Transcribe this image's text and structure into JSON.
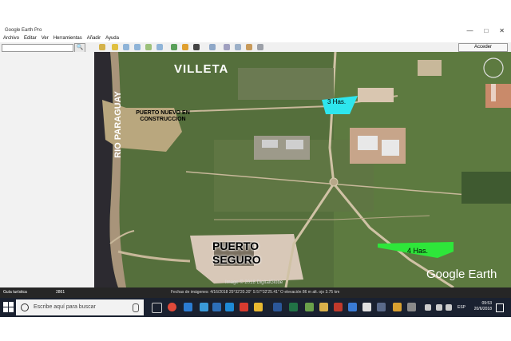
{
  "window": {
    "title": "Google Earth Pro",
    "controls": [
      "—",
      "□",
      "✕"
    ]
  },
  "menu": [
    "Archivo",
    "Editar",
    "Ver",
    "Herramientas",
    "Añadir",
    "Ayuda"
  ],
  "toolbar": {
    "search_button": "🔍",
    "login_label": "Acceder"
  },
  "map": {
    "labels": {
      "villeta": "VILLETA",
      "rio": "RIO PARAGUAY",
      "puerto_nuevo": "PUERTO NUEVO EN CONSTRUCCION",
      "puerto_seguro_1": "PUERTO",
      "puerto_seguro_2": "SEGURO",
      "area_3": "3 Has.",
      "area_4": "4 Has.",
      "brand": "Google Earth",
      "copyright": "Image © 2018 DigitalGlobe"
    },
    "colors": {
      "area_3": "#2ee6ee",
      "area_4": "#2ee63a",
      "river": "#2c2a30",
      "road": "#c8b89a"
    }
  },
  "statusbar": {
    "tour": "Guía turística",
    "tour_count": "2861",
    "info": "Fechas de imágenes: 4/16/2018     25°32'20.20\" S    57°32'25.41\" O   elevación    86 m    alt. ojo   3.75 km"
  },
  "taskbar": {
    "search_placeholder": "Escribe aquí para buscar",
    "tray_lang": "ESP",
    "time": "09:53",
    "date": "20/6/2018"
  }
}
